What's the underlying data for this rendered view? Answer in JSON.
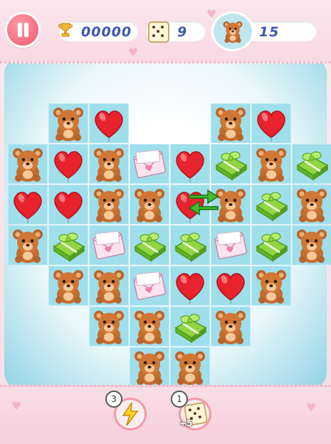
{
  "hud": {
    "score": "00000",
    "moves": "9",
    "bear_target": "15"
  },
  "boosters": [
    {
      "name": "lightning",
      "count": "3"
    },
    {
      "name": "dice",
      "count": "1",
      "label": "+5"
    }
  ],
  "colors": {
    "accent": "#ef5a6d",
    "text_blue": "#3b56b5",
    "cell": "#9fdeeb"
  },
  "board": {
    "rows": 7,
    "cols": 8,
    "cells": [
      [
        "",
        "bear",
        "heart",
        "",
        "",
        "bear",
        "heart",
        ""
      ],
      [
        "bear",
        "heart",
        "bear",
        "letter",
        "heart",
        "gift",
        "bear",
        "gift"
      ],
      [
        "heart",
        "heart",
        "bear",
        "bear",
        "heart",
        "bear",
        "gift",
        "bear"
      ],
      [
        "bear",
        "gift",
        "letter",
        "gift",
        "gift",
        "letter",
        "gift",
        "bear"
      ],
      [
        "",
        "bear",
        "bear",
        "letter",
        "heart",
        "heart",
        "bear",
        ""
      ],
      [
        "",
        "",
        "bear",
        "bear",
        "gift",
        "bear",
        "",
        ""
      ],
      [
        "",
        "",
        "",
        "bear",
        "bear",
        "",
        "",
        ""
      ]
    ]
  }
}
